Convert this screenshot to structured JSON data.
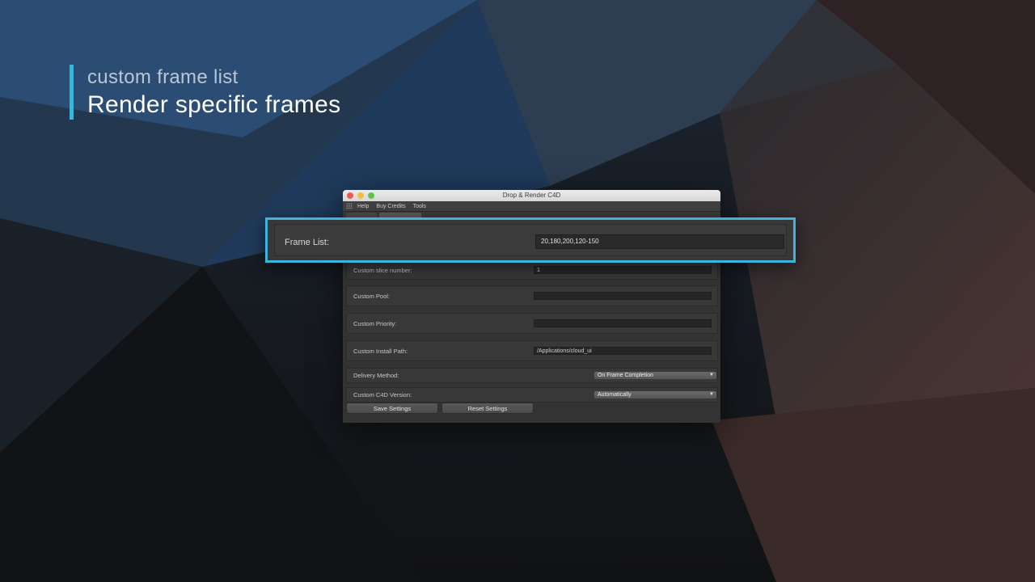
{
  "caption": {
    "subtitle": "custom frame list",
    "title": "Render specific frames"
  },
  "window": {
    "title": "Drop & Render C4D",
    "menu": [
      "Help",
      "Buy Credits",
      "Tools"
    ]
  },
  "highlight": {
    "label": "Frame List:",
    "value": "20,180,200,120-150"
  },
  "fields": [
    {
      "label": "Custom slice number:",
      "value": "1"
    },
    {
      "label": "Custom Pool:",
      "value": ""
    },
    {
      "label": "Custom Priority:",
      "value": ""
    },
    {
      "label": "Custom Install Path:",
      "value": "/Applications/cloud_ui"
    }
  ],
  "dropdowns": [
    {
      "label": "Delivery Method:",
      "value": "On Frame Completion"
    },
    {
      "label": "Custom C4D Version:",
      "value": "Automatically"
    }
  ],
  "buttons": {
    "save": "Save Settings",
    "reset": "Reset Settings"
  },
  "colors": {
    "accent": "#3fb4da"
  }
}
